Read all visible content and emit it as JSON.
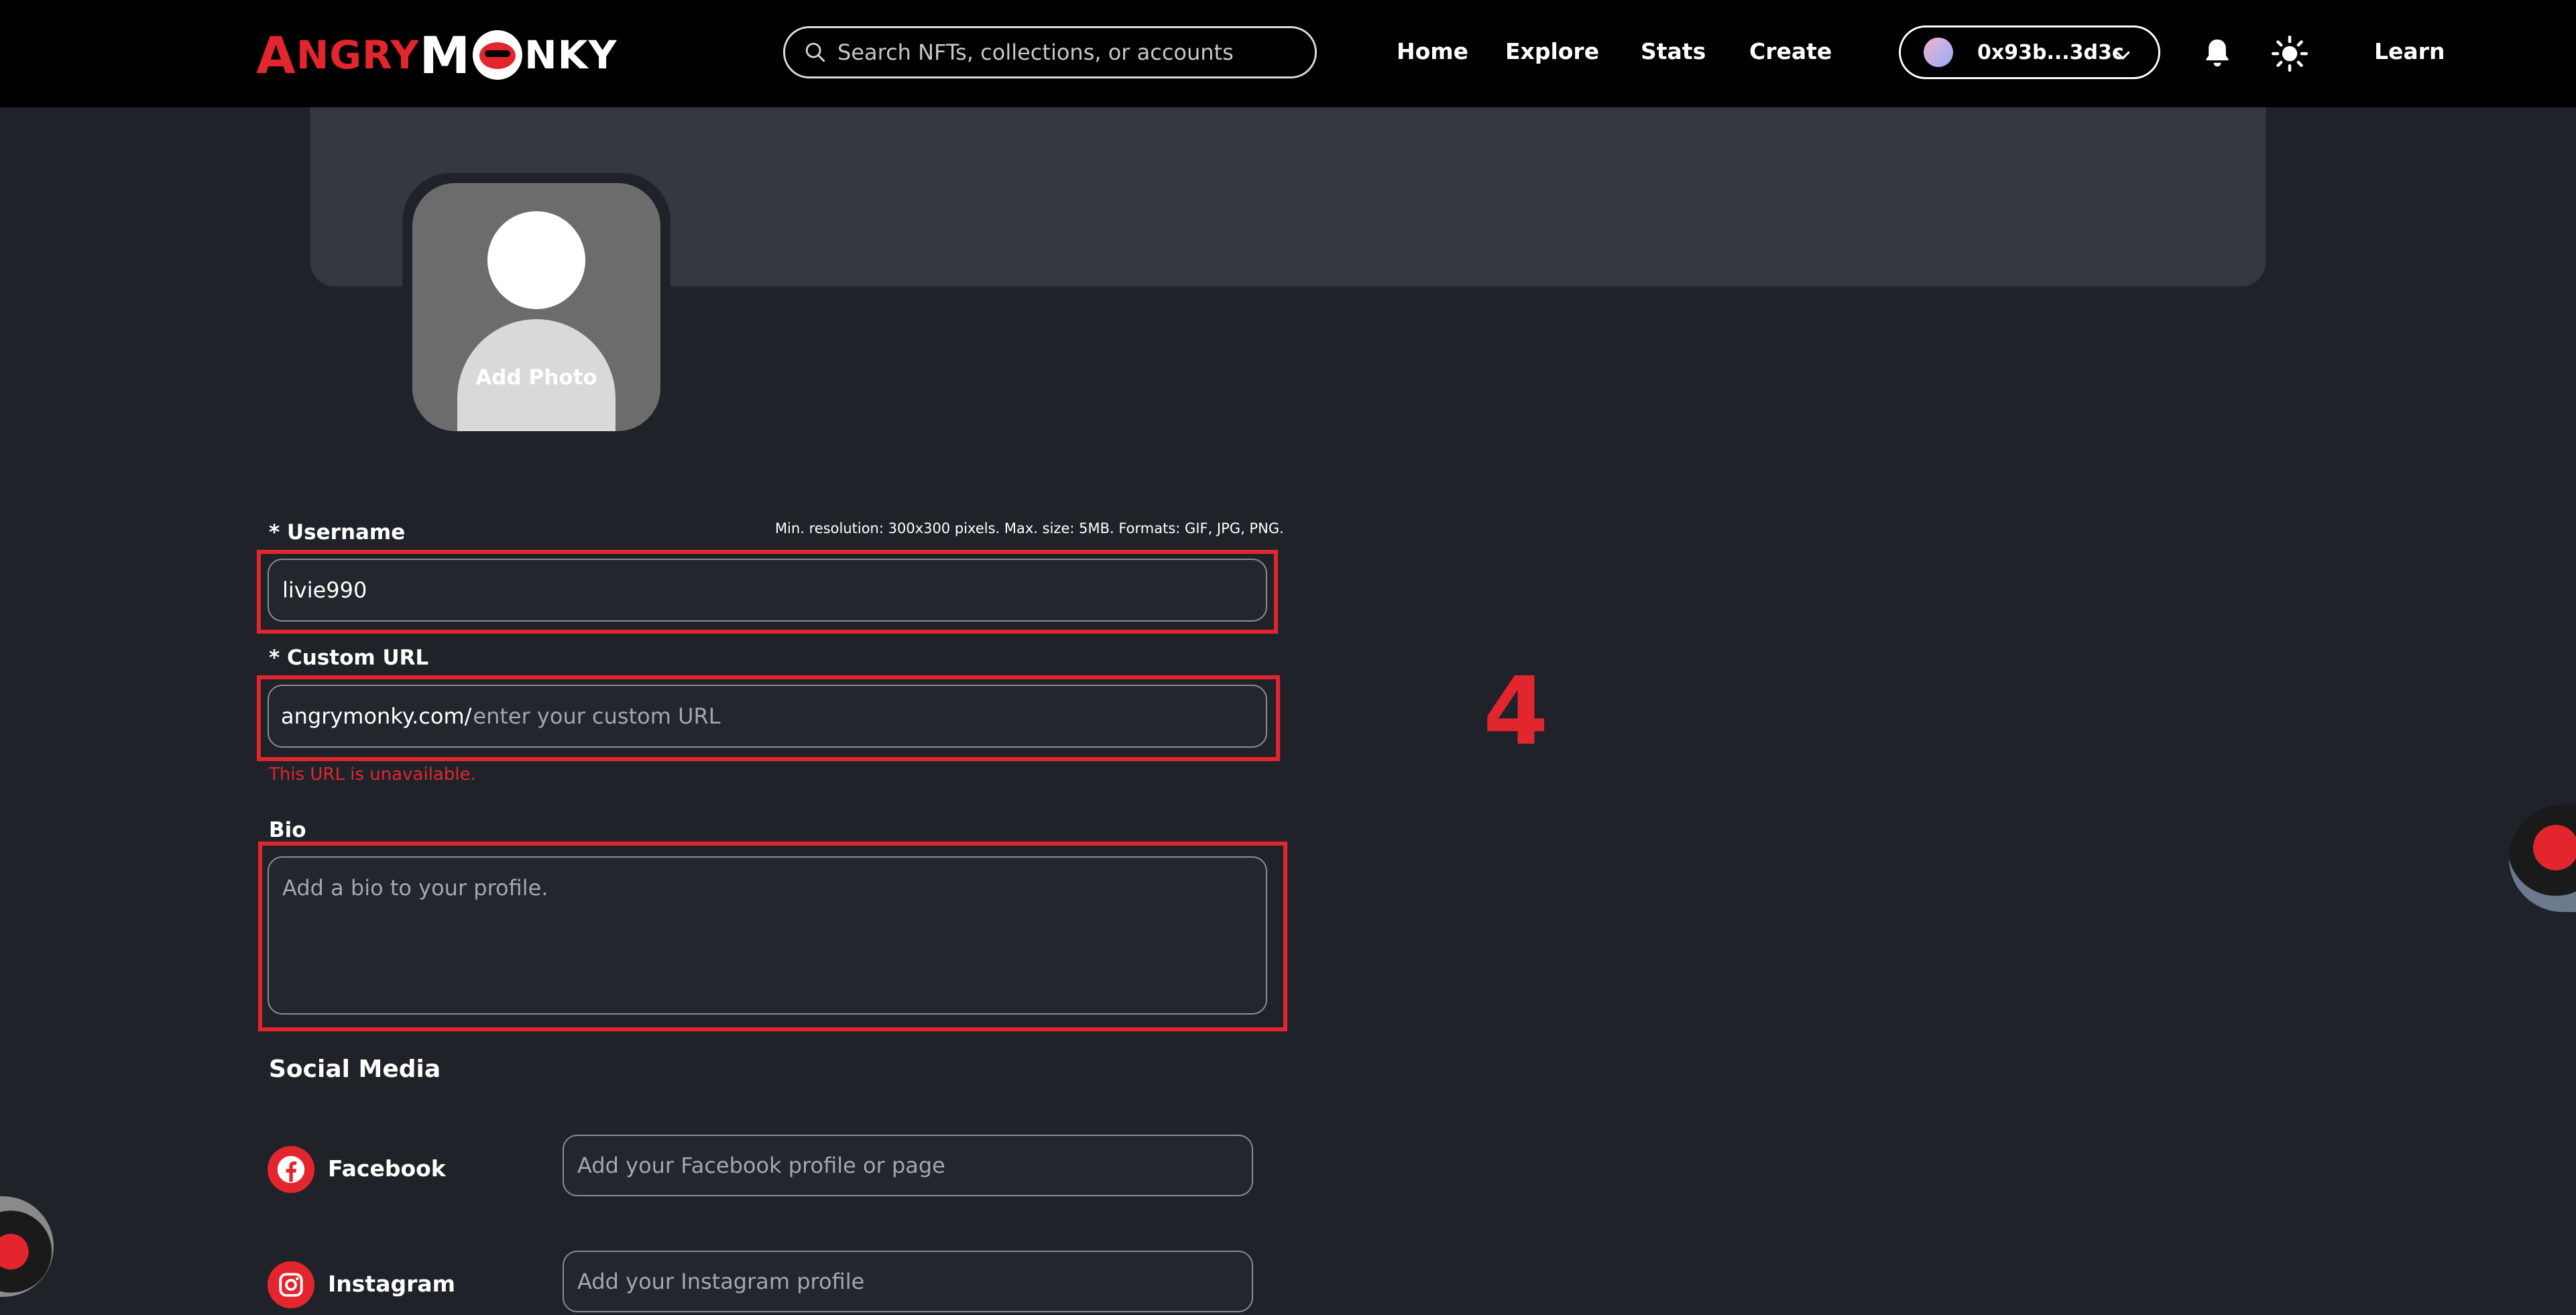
{
  "header": {
    "logo_text": {
      "a": "A",
      "ngry": "NGRY",
      "m": "M",
      "nky": "NKY"
    },
    "search_placeholder": "Search NFTs, collections, or accounts",
    "nav": {
      "home": "Home",
      "explore": "Explore",
      "stats": "Stats",
      "create": "Create",
      "learn": "Learn"
    },
    "wallet_address": "0x93b...3d3c"
  },
  "profile": {
    "add_photo_label": "Add Photo",
    "image_hint": "Min. resolution: 300x300 pixels. Max. size: 5MB. Formats: GIF, JPG, PNG."
  },
  "form": {
    "username": {
      "label": "* Username",
      "value": "livie990"
    },
    "custom_url": {
      "label": "* Custom URL",
      "prefix": "angrymonky.com/",
      "placeholder": "enter your custom URL",
      "error": "This URL is unavailable."
    },
    "bio": {
      "label": "Bio",
      "placeholder": "Add a bio to your profile."
    }
  },
  "annotation": {
    "step_number": "4"
  },
  "social": {
    "title": "Social Media",
    "facebook": {
      "label": "Facebook",
      "placeholder": "Add your Facebook profile or page"
    },
    "instagram": {
      "label": "Instagram",
      "placeholder": "Add your Instagram profile"
    }
  },
  "colors": {
    "brand_red": "#e3262d",
    "background": "#1f2329",
    "banner": "#353840",
    "header": "#000000"
  }
}
